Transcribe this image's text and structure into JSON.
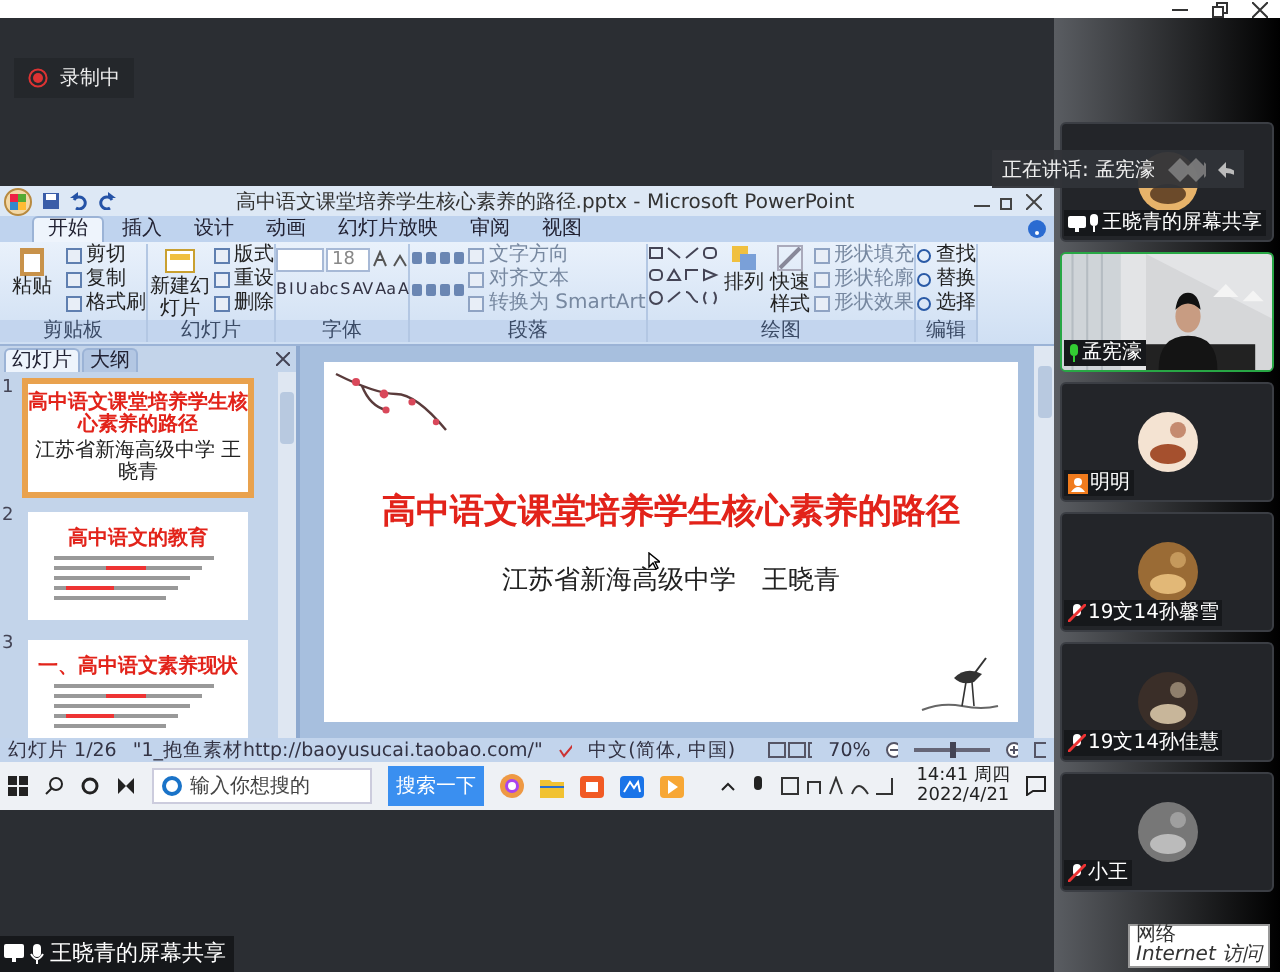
{
  "recording": {
    "label": "录制中"
  },
  "speaker_banner": {
    "label": "正在讲话: 孟宪濠"
  },
  "shared_screen": {
    "app_title": "高中语文课堂培养学生核心素养的路径.pptx - Microsoft PowerPoint",
    "ribbon_tabs": [
      {
        "label": "开始",
        "selected": true
      },
      {
        "label": "插入",
        "selected": false
      },
      {
        "label": "设计",
        "selected": false
      },
      {
        "label": "动画",
        "selected": false
      },
      {
        "label": "幻灯片放映",
        "selected": false
      },
      {
        "label": "审阅",
        "selected": false
      },
      {
        "label": "视图",
        "selected": false
      }
    ],
    "ribbon_groups": [
      {
        "kind": "clipboard",
        "label": "剪贴板",
        "large": [
          "粘贴"
        ],
        "items": [
          "剪切",
          "复制",
          "格式刷"
        ]
      },
      {
        "kind": "slides",
        "label": "幻灯片",
        "large": [
          "新建幻灯片"
        ],
        "items": [
          "版式",
          "重设",
          "删除"
        ]
      },
      {
        "kind": "font",
        "label": "字体",
        "font_size": "18",
        "format_buttons": [
          "B",
          "I",
          "U",
          "abc",
          "S",
          "AV",
          "Aa",
          "A"
        ]
      },
      {
        "kind": "paragraph",
        "label": "段落",
        "items": [
          "文字方向",
          "对齐文本",
          "转换为 SmartArt"
        ]
      },
      {
        "kind": "drawing",
        "label": "绘图",
        "large": [
          "排列",
          "快速样式"
        ],
        "items": [
          "形状填充",
          "形状轮廓",
          "形状效果"
        ]
      },
      {
        "kind": "editing",
        "label": "编辑",
        "items": [
          "查找",
          "替换",
          "选择"
        ]
      }
    ],
    "panel_tabs": [
      {
        "label": "幻灯片",
        "selected": true
      },
      {
        "label": "大纲",
        "selected": false
      }
    ],
    "slides": [
      {
        "number": "1",
        "selected": true,
        "title": "高中语文课堂培养学生核心素养的路径",
        "subtitle": "江苏省新海高级中学 王晓青"
      },
      {
        "number": "2",
        "selected": false,
        "title": "高中语文的教育"
      },
      {
        "number": "3",
        "selected": false,
        "title": "一、高中语文素养现状"
      }
    ],
    "current_slide": {
      "title": "高中语文课堂培养学生核心素养的路径",
      "subtitle": "江苏省新海高级中学　王晓青"
    },
    "status_bar": {
      "slide": "幻灯片 1/26",
      "theme": "\"1_抱鱼素材http://baoyusucai.taobao.com/\"",
      "language": "中文(简体, 中国)",
      "zoom": "70%",
      "zoom_slider": {
        "level": 0.5
      }
    },
    "taskbar": {
      "search_placeholder": "输入你想搜的",
      "search_button": "搜索一下",
      "time": "14:41 周四",
      "date": "2022/4/21"
    }
  },
  "participants": [
    {
      "name": "王晓青的屏幕共享",
      "kind": "screen-share",
      "speaking": false,
      "muted": false
    },
    {
      "name": "孟宪濠",
      "kind": "camera",
      "speaking": true,
      "muted": false
    },
    {
      "name": "明明",
      "kind": "guest",
      "speaking": false
    },
    {
      "name": "19文14孙馨雪",
      "kind": "member",
      "speaking": false,
      "muted": true
    },
    {
      "name": "19文14孙佳慧",
      "kind": "member",
      "speaking": false,
      "muted": true
    },
    {
      "name": "小王",
      "kind": "member",
      "speaking": false,
      "muted": true
    }
  ],
  "share_label": {
    "label": "王晓青的屏幕共享"
  },
  "tooltip": {
    "title": "网络",
    "text": "Internet 访问"
  }
}
